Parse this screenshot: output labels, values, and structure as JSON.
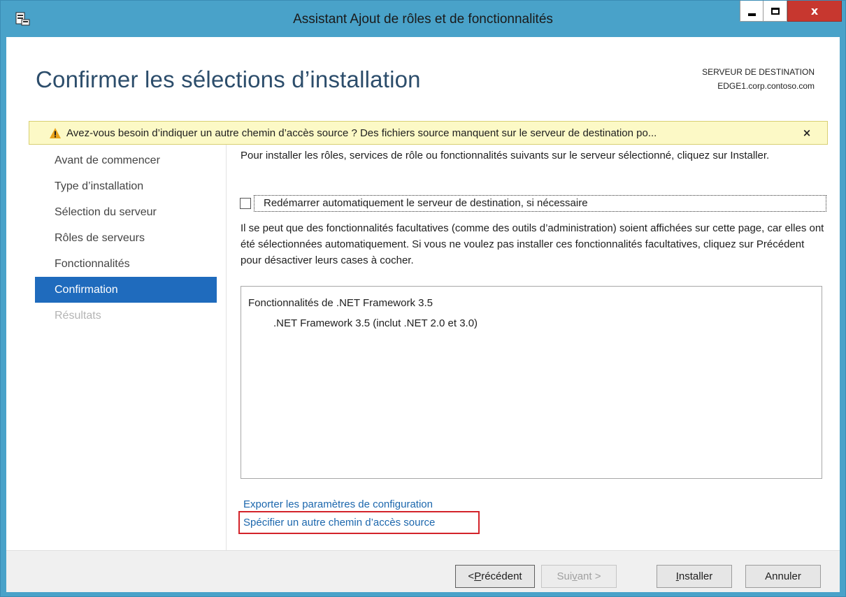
{
  "window": {
    "title": "Assistant Ajout de rôles et de fonctionnalités",
    "accent_color": "#49a2c9",
    "close_color": "#c7372f"
  },
  "header": {
    "page_title": "Confirmer les sélections d’installation",
    "destination_label": "SERVEUR DE DESTINATION",
    "destination_server": "EDGE1.corp.contoso.com"
  },
  "warning": {
    "text": "Avez-vous besoin d’indiquer un autre chemin d’accès source ? Des fichiers source manquent sur le serveur de destination po...",
    "icon": "warning-triangle-icon",
    "close_glyph": "×"
  },
  "sidebar": {
    "items": [
      {
        "label": "Avant de commencer",
        "state": "normal"
      },
      {
        "label": "Type d’installation",
        "state": "normal"
      },
      {
        "label": "Sélection du serveur",
        "state": "normal"
      },
      {
        "label": "Rôles de serveurs",
        "state": "normal"
      },
      {
        "label": "Fonctionnalités",
        "state": "normal"
      },
      {
        "label": "Confirmation",
        "state": "active"
      },
      {
        "label": "Résultats",
        "state": "disabled"
      }
    ],
    "active_color": "#1f6bbd"
  },
  "main": {
    "intro": "Pour installer les rôles, services de rôle ou fonctionnalités suivants sur le serveur sélectionné, cliquez sur Installer.",
    "restart_checkbox": {
      "label": "Redémarrer automatiquement le serveur de destination, si nécessaire",
      "checked": false
    },
    "optional_note": "Il se peut que des fonctionnalités facultatives (comme des outils d’administration) soient affichées sur cette page, car elles ont été sélectionnées automatiquement. Si vous ne voulez pas installer ces fonctionnalités facultatives, cliquez sur Précédent pour désactiver leurs cases à cocher.",
    "selection_list": [
      {
        "label": "Fonctionnalités de .NET Framework 3.5",
        "level": 0
      },
      {
        "label": ".NET Framework 3.5 (inclut .NET 2.0 et 3.0)",
        "level": 1
      }
    ],
    "link_export": "Exporter les paramètres de configuration",
    "link_source": "Spécifier un autre chemin d’accès source"
  },
  "footer": {
    "prev_label_accel": "P",
    "prev_label_rest": "récédent",
    "prev_prefix": "< ",
    "next_label_pre": "Sui",
    "next_label_accel": "v",
    "next_label_post": "ant >",
    "install_label_accel": "I",
    "install_label_rest": "nstaller",
    "cancel_label": "Annuler"
  }
}
